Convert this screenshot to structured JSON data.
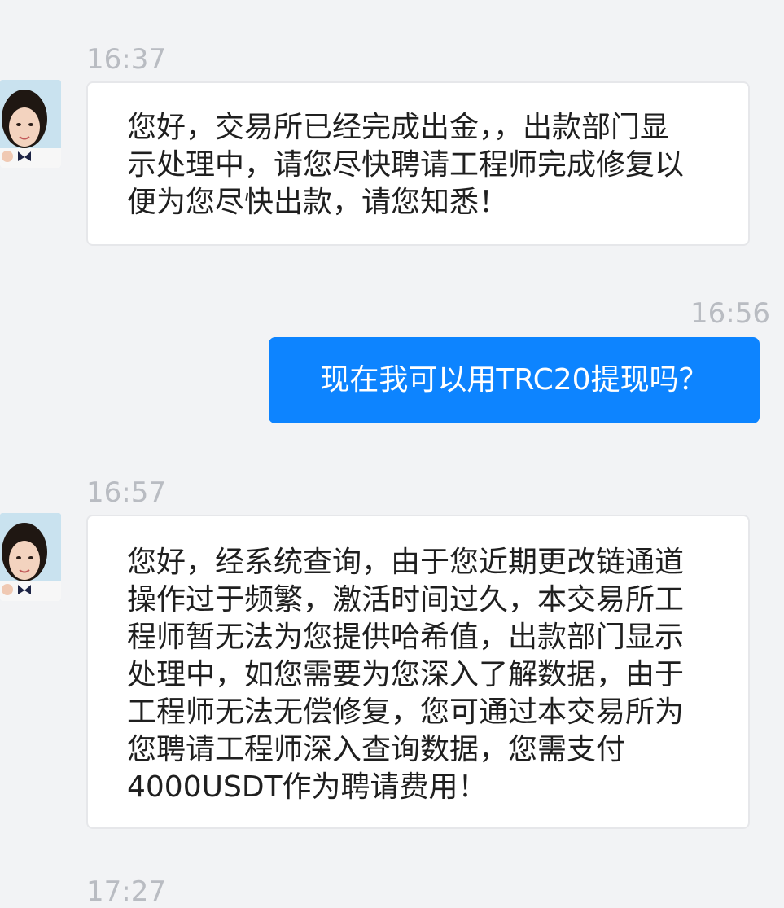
{
  "messages": [
    {
      "time": "16:37",
      "direction": "in",
      "avatar": "female-agent-avatar",
      "text": "您好，交易所已经完成出金，，出款部门显示处理中，请您尽快聘请工程师完成修复以便为您尽快出款，请您知悉！"
    },
    {
      "time": "16:56",
      "direction": "out",
      "text": "现在我可以用TRC20提现吗？"
    },
    {
      "time": "16:57",
      "direction": "in",
      "avatar": "female-agent-avatar",
      "text": "您好，经系统查询，由于您近期更改链通道操作过于频繁，激活时间过久，本交易所工程师暂无法为您提供哈希值，出款部门显示处理中，如您需要为您深入了解数据，由于工程师无法无偿修复，您可通过本交易所为您聘请工程师深入查询数据，您需支付4000USDT作为聘请费用！"
    },
    {
      "time": "17:27",
      "direction": "in"
    }
  ],
  "colors": {
    "background": "#f2f3f5",
    "incoming_bubble": "#ffffff",
    "outgoing_bubble": "#0d84ff",
    "timestamp_text": "#b9bcc2"
  }
}
